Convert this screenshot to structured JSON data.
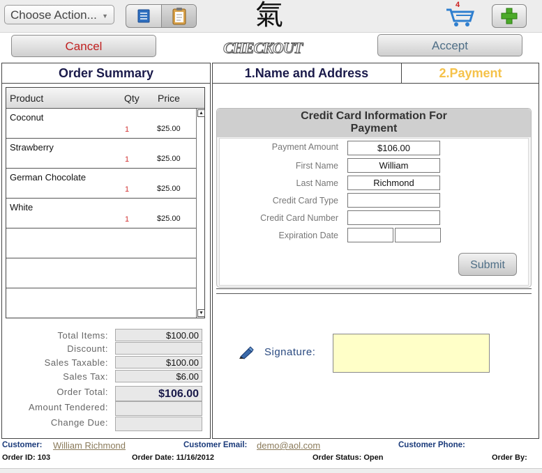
{
  "toolbar": {
    "choose_action": "Choose Action...",
    "logo_glyph": "氣",
    "cart_count": "4",
    "accent_blue": "#2f6fbf",
    "add_green": "#4caa2a"
  },
  "header": {
    "cancel_label": "Cancel",
    "title": "CHECKOUT",
    "accept_label": "Accept"
  },
  "order_summary": {
    "title": "Order Summary",
    "columns": [
      "Product",
      "Qty",
      "Price"
    ],
    "items": [
      {
        "product": "Coconut",
        "qty": "1",
        "price": "$25.00"
      },
      {
        "product": "Strawberry",
        "qty": "1",
        "price": "$25.00"
      },
      {
        "product": "German Chocolate",
        "qty": "1",
        "price": "$25.00"
      },
      {
        "product": "White",
        "qty": "1",
        "price": "$25.00"
      }
    ],
    "totals": {
      "total_items_label": "Total Items:",
      "total_items": "$100.00",
      "discount_label": "Discount:",
      "discount": "",
      "sales_taxable_label": "Sales Taxable:",
      "sales_taxable": "$100.00",
      "sales_tax_label": "Sales Tax:",
      "sales_tax": "$6.00",
      "order_total_label": "Order Total:",
      "order_total": "$106.00",
      "amount_tendered_label": "Amount Tendered:",
      "amount_tendered": "",
      "change_due_label": "Change Due:",
      "change_due": ""
    }
  },
  "tabs": {
    "name_address": "1.Name and Address",
    "payment": "2.Payment"
  },
  "credit_card": {
    "title_line1": "Credit Card Information For",
    "title_line2": "Payment",
    "fields": [
      {
        "label": "Payment Amount",
        "value": "$106.00"
      },
      {
        "label": "First Name",
        "value": "William"
      },
      {
        "label": "Last Name",
        "value": "Richmond"
      },
      {
        "label": "Credit Card Type",
        "value": ""
      },
      {
        "label": "Credit Card Number",
        "value": ""
      },
      {
        "label": "Expiration Date",
        "value": ""
      }
    ],
    "submit_label": "Submit"
  },
  "signature": {
    "label": "Signature:"
  },
  "footer": {
    "customer_label": "Customer:",
    "customer": "William Richmond",
    "email_label": "Customer Email:",
    "email": "demo@aol.com",
    "phone_label": "Customer Phone:",
    "order_id": "Order ID: 103",
    "order_date": "Order Date: 11/16/2012",
    "order_status": "Order Status: Open",
    "order_by": "Order By:"
  }
}
